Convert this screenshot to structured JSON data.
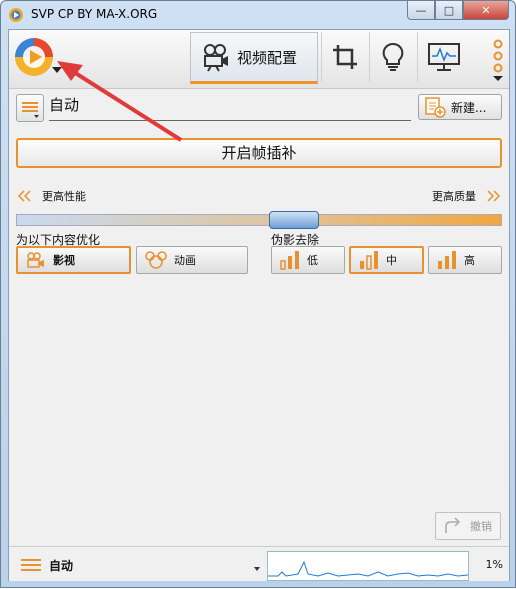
{
  "window": {
    "title": "SVP CP BY MA-X.ORG"
  },
  "caption_buttons": {
    "minimize": "—",
    "maximize": "□",
    "close": "✕"
  },
  "toolbar": {
    "active_tab_label": "视频配置",
    "tabs": [
      {
        "name": "video-config",
        "icon": "camera-icon"
      },
      {
        "name": "crop",
        "icon": "crop-icon"
      },
      {
        "name": "tips",
        "icon": "lightbulb-icon"
      },
      {
        "name": "monitor",
        "icon": "monitor-icon"
      },
      {
        "name": "more",
        "icon": "vertical-dots-icon"
      }
    ]
  },
  "profile": {
    "name": "自动",
    "new_button": "新建..."
  },
  "frame_interpolation_button": "开启帧插补",
  "performance": {
    "left_label": "更高性能",
    "right_label": "更高质量",
    "level": 0.58
  },
  "optimize": {
    "label": "为以下内容优化",
    "options": [
      {
        "label": "影视",
        "selected": true
      },
      {
        "label": "动画",
        "selected": false
      }
    ]
  },
  "artifact": {
    "label": "伪影去除",
    "options": [
      {
        "label": "低",
        "selected": false
      },
      {
        "label": "中",
        "selected": true
      },
      {
        "label": "高",
        "selected": false
      }
    ]
  },
  "undo_button": "撤销",
  "status": {
    "profile": "自动",
    "cpu_percent": "1%"
  },
  "colors": {
    "accent": "#e8912f",
    "arrow": "#e03a3a",
    "thumb": "#6f9fd6"
  }
}
